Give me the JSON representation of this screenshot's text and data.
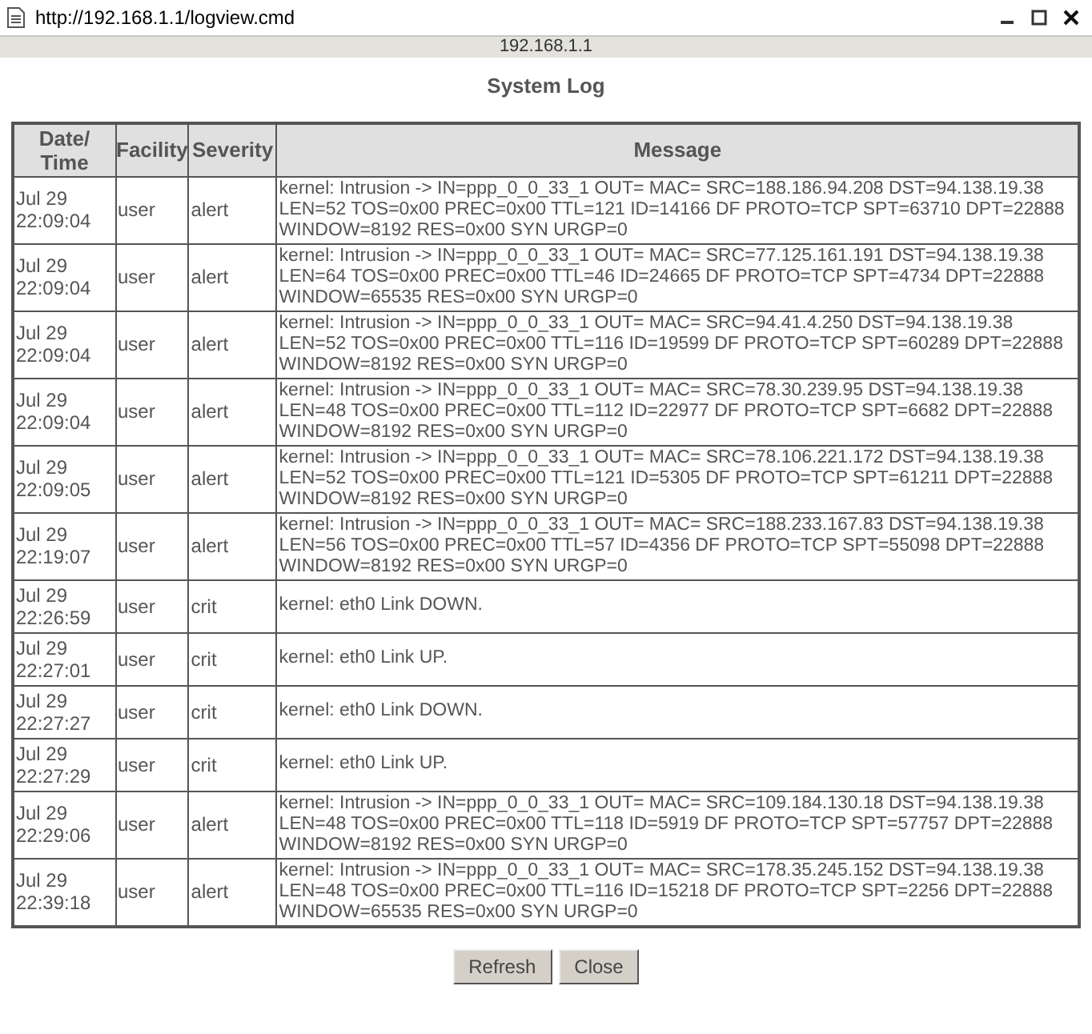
{
  "window": {
    "title": "http://192.168.1.1/logview.cmd",
    "address": "192.168.1.1"
  },
  "heading": "System Log",
  "table": {
    "columns": [
      "Date/ Time",
      "Facility",
      "Severity",
      "Message"
    ],
    "rows": [
      {
        "date": "Jul 29 22:09:04",
        "facility": "user",
        "severity": "alert",
        "message": "kernel: Intrusion -> IN=ppp_0_0_33_1 OUT= MAC= SRC=188.186.94.208 DST=94.138.19.38 LEN=52 TOS=0x00 PREC=0x00 TTL=121 ID=14166 DF PROTO=TCP SPT=63710 DPT=22888 WINDOW=8192 RES=0x00 SYN URGP=0"
      },
      {
        "date": "Jul 29 22:09:04",
        "facility": "user",
        "severity": "alert",
        "message": "kernel: Intrusion -> IN=ppp_0_0_33_1 OUT= MAC= SRC=77.125.161.191 DST=94.138.19.38 LEN=64 TOS=0x00 PREC=0x00 TTL=46 ID=24665 DF PROTO=TCP SPT=4734 DPT=22888 WINDOW=65535 RES=0x00 SYN URGP=0"
      },
      {
        "date": "Jul 29 22:09:04",
        "facility": "user",
        "severity": "alert",
        "message": "kernel: Intrusion -> IN=ppp_0_0_33_1 OUT= MAC= SRC=94.41.4.250 DST=94.138.19.38 LEN=52 TOS=0x00 PREC=0x00 TTL=116 ID=19599 DF PROTO=TCP SPT=60289 DPT=22888 WINDOW=8192 RES=0x00 SYN URGP=0"
      },
      {
        "date": "Jul 29 22:09:04",
        "facility": "user",
        "severity": "alert",
        "message": "kernel: Intrusion -> IN=ppp_0_0_33_1 OUT= MAC= SRC=78.30.239.95 DST=94.138.19.38 LEN=48 TOS=0x00 PREC=0x00 TTL=112 ID=22977 DF PROTO=TCP SPT=6682 DPT=22888 WINDOW=8192 RES=0x00 SYN URGP=0"
      },
      {
        "date": "Jul 29 22:09:05",
        "facility": "user",
        "severity": "alert",
        "message": "kernel: Intrusion -> IN=ppp_0_0_33_1 OUT= MAC= SRC=78.106.221.172 DST=94.138.19.38 LEN=52 TOS=0x00 PREC=0x00 TTL=121 ID=5305 DF PROTO=TCP SPT=61211 DPT=22888 WINDOW=8192 RES=0x00 SYN URGP=0"
      },
      {
        "date": "Jul 29 22:19:07",
        "facility": "user",
        "severity": "alert",
        "message": "kernel: Intrusion -> IN=ppp_0_0_33_1 OUT= MAC= SRC=188.233.167.83 DST=94.138.19.38 LEN=56 TOS=0x00 PREC=0x00 TTL=57 ID=4356 DF PROTO=TCP SPT=55098 DPT=22888 WINDOW=8192 RES=0x00 SYN URGP=0"
      },
      {
        "date": "Jul 29 22:26:59",
        "facility": "user",
        "severity": "crit",
        "message": "kernel: eth0 Link DOWN."
      },
      {
        "date": "Jul 29 22:27:01",
        "facility": "user",
        "severity": "crit",
        "message": "kernel: eth0 Link UP."
      },
      {
        "date": "Jul 29 22:27:27",
        "facility": "user",
        "severity": "crit",
        "message": "kernel: eth0 Link DOWN."
      },
      {
        "date": "Jul 29 22:27:29",
        "facility": "user",
        "severity": "crit",
        "message": "kernel: eth0 Link UP."
      },
      {
        "date": "Jul 29 22:29:06",
        "facility": "user",
        "severity": "alert",
        "message": "kernel: Intrusion -> IN=ppp_0_0_33_1 OUT= MAC= SRC=109.184.130.18 DST=94.138.19.38 LEN=48 TOS=0x00 PREC=0x00 TTL=118 ID=5919 DF PROTO=TCP SPT=57757 DPT=22888 WINDOW=8192 RES=0x00 SYN URGP=0"
      },
      {
        "date": "Jul 29 22:39:18",
        "facility": "user",
        "severity": "alert",
        "message": "kernel: Intrusion -> IN=ppp_0_0_33_1 OUT= MAC= SRC=178.35.245.152 DST=94.138.19.38 LEN=48 TOS=0x00 PREC=0x00 TTL=116 ID=15218 DF PROTO=TCP SPT=2256 DPT=22888 WINDOW=65535 RES=0x00 SYN URGP=0"
      }
    ]
  },
  "buttons": [
    "Refresh",
    "Close"
  ]
}
